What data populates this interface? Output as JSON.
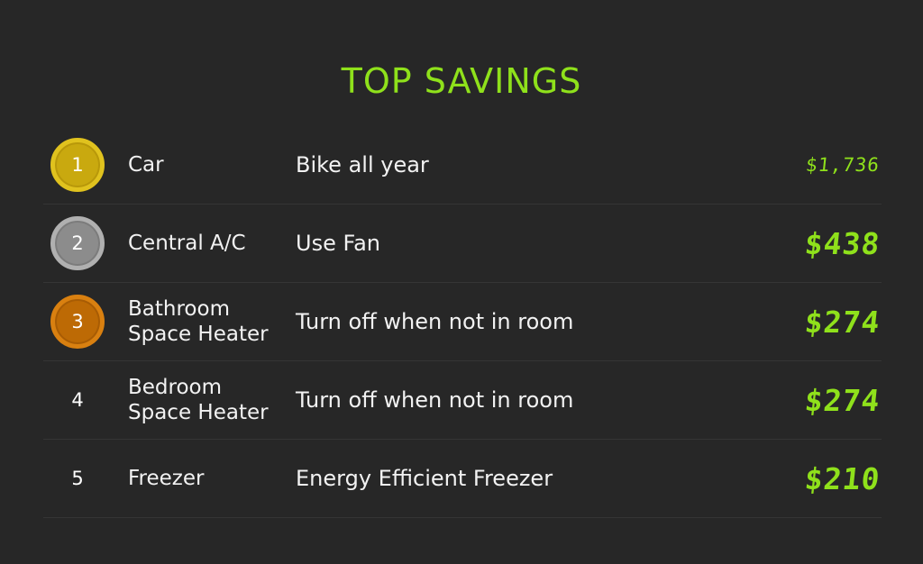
{
  "title": "TOP SAVINGS",
  "colors": {
    "background": "#272727",
    "accent": "#8fe11b",
    "gold": "#c9a90f",
    "silver": "#8c8c8c",
    "bronze": "#bd6a05"
  },
  "rows": [
    {
      "rank": "1",
      "medal": "gold",
      "item": "Car",
      "action": "Bike all year",
      "amount": "$1,736"
    },
    {
      "rank": "2",
      "medal": "silver",
      "item": "Central A/C",
      "action": "Use Fan",
      "amount": "$438"
    },
    {
      "rank": "3",
      "medal": "bronze",
      "item": "Bathroom Space Heater",
      "action": "Turn off when not in room",
      "amount": "$274"
    },
    {
      "rank": "4",
      "medal": "none",
      "item": "Bedroom Space Heater",
      "action": "Turn off when not in room",
      "amount": "$274"
    },
    {
      "rank": "5",
      "medal": "none",
      "item": "Freezer",
      "action": "Energy Efficient Freezer",
      "amount": "$210"
    }
  ]
}
